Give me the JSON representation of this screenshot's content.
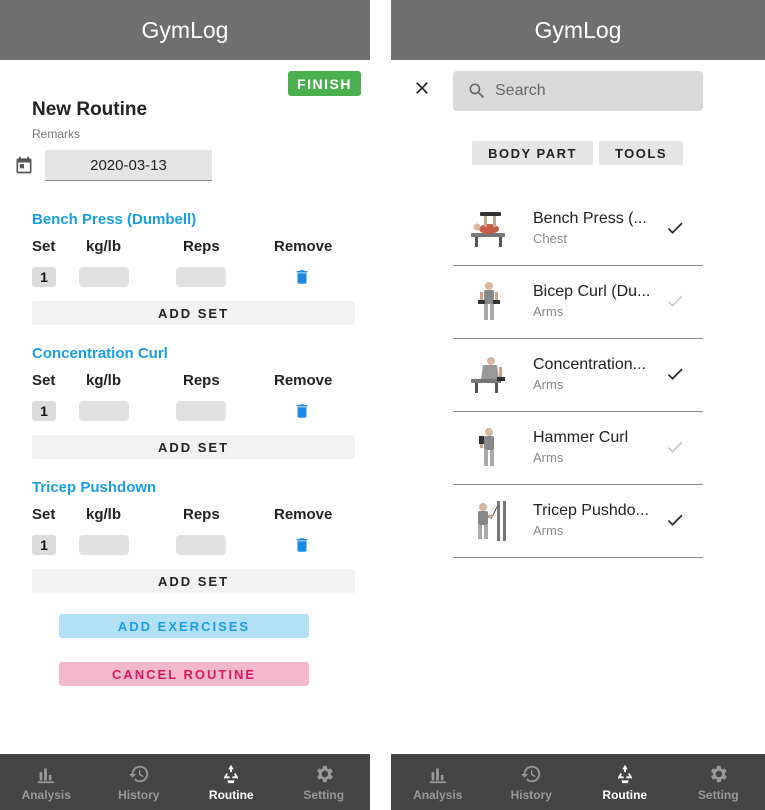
{
  "left": {
    "header": {
      "title": "GymLog"
    },
    "finish_label": "FINISH",
    "routine_title": "New Routine",
    "remarks_label": "Remarks",
    "date_value": "2020-03-13",
    "columns": {
      "set": "Set",
      "weight": "kg/lb",
      "reps": "Reps",
      "remove": "Remove"
    },
    "exercises": [
      {
        "name": "Bench Press (Dumbell)",
        "set_number": "1",
        "add_set_label": "ADD SET"
      },
      {
        "name": "Concentration Curl",
        "set_number": "1",
        "add_set_label": "ADD SET"
      },
      {
        "name": "Tricep Pushdown",
        "set_number": "1",
        "add_set_label": "ADD SET"
      }
    ],
    "add_exercises_label": "ADD EXERCISES",
    "cancel_routine_label": "CANCEL ROUTINE"
  },
  "right": {
    "header": {
      "title": "GymLog"
    },
    "search": {
      "placeholder": "Search"
    },
    "filters": {
      "body_part": "BODY PART",
      "tools": "TOOLS"
    },
    "exercise_list": [
      {
        "name": "Bench Press (...",
        "part": "Chest",
        "selected": true
      },
      {
        "name": "Bicep Curl (Du...",
        "part": "Arms",
        "selected": false
      },
      {
        "name": "Concentration...",
        "part": "Arms",
        "selected": true
      },
      {
        "name": "Hammer Curl",
        "part": "Arms",
        "selected": false
      },
      {
        "name": "Tricep Pushdo...",
        "part": "Arms",
        "selected": true
      }
    ]
  },
  "nav": [
    {
      "label": "Analysis",
      "icon": "bar-chart-icon",
      "active": false
    },
    {
      "label": "History",
      "icon": "history-icon",
      "active": false
    },
    {
      "label": "Routine",
      "icon": "recycle-icon",
      "active": true
    },
    {
      "label": "Setting",
      "icon": "gear-icon",
      "active": false
    }
  ],
  "colors": {
    "header": "#6f6f6f",
    "nav": "#444444",
    "finish": "#4caf50",
    "accent_blue": "#1a9ee0",
    "cancel_pink": "#d81b60"
  }
}
